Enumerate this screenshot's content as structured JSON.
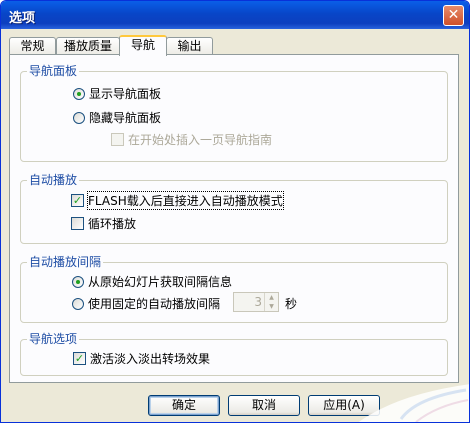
{
  "window": {
    "title": "选项",
    "close_glyph": "✕"
  },
  "tabs": [
    {
      "label": "常规",
      "active": false
    },
    {
      "label": "播放质量",
      "active": false
    },
    {
      "label": "导航",
      "active": true
    },
    {
      "label": "输出",
      "active": false
    }
  ],
  "nav_panel": {
    "title": "导航面板",
    "show_option": {
      "label": "显示导航面板",
      "selected": true
    },
    "hide_option": {
      "label": "隐藏导航面板",
      "selected": false
    },
    "insert_guide": {
      "label": "在开始处插入一页导航指南",
      "checked": false,
      "enabled": false
    }
  },
  "autoplay": {
    "title": "自动播放",
    "flash_autoplay": {
      "label": "FLASH载入后直接进入自动播放模式",
      "checked": true
    },
    "loop": {
      "label": "循环播放",
      "checked": false
    }
  },
  "interval": {
    "title": "自动播放间隔",
    "from_source": {
      "label": "从原始幻灯片获取间隔信息",
      "selected": true
    },
    "fixed": {
      "label": "使用固定的自动播放间隔",
      "selected": false
    },
    "seconds_value": "3",
    "unit": "秒"
  },
  "nav_options": {
    "title": "导航选项",
    "fade_effect": {
      "label": "激活淡入淡出转场效果",
      "checked": true
    }
  },
  "buttons": {
    "ok": "确定",
    "cancel": "取消",
    "apply": "应用(A)"
  },
  "colors": {
    "title_bar": "#0846c8",
    "group_title": "#1f4ea5",
    "check_mark": "#21a121",
    "tab_highlight": "#ffc83c"
  }
}
